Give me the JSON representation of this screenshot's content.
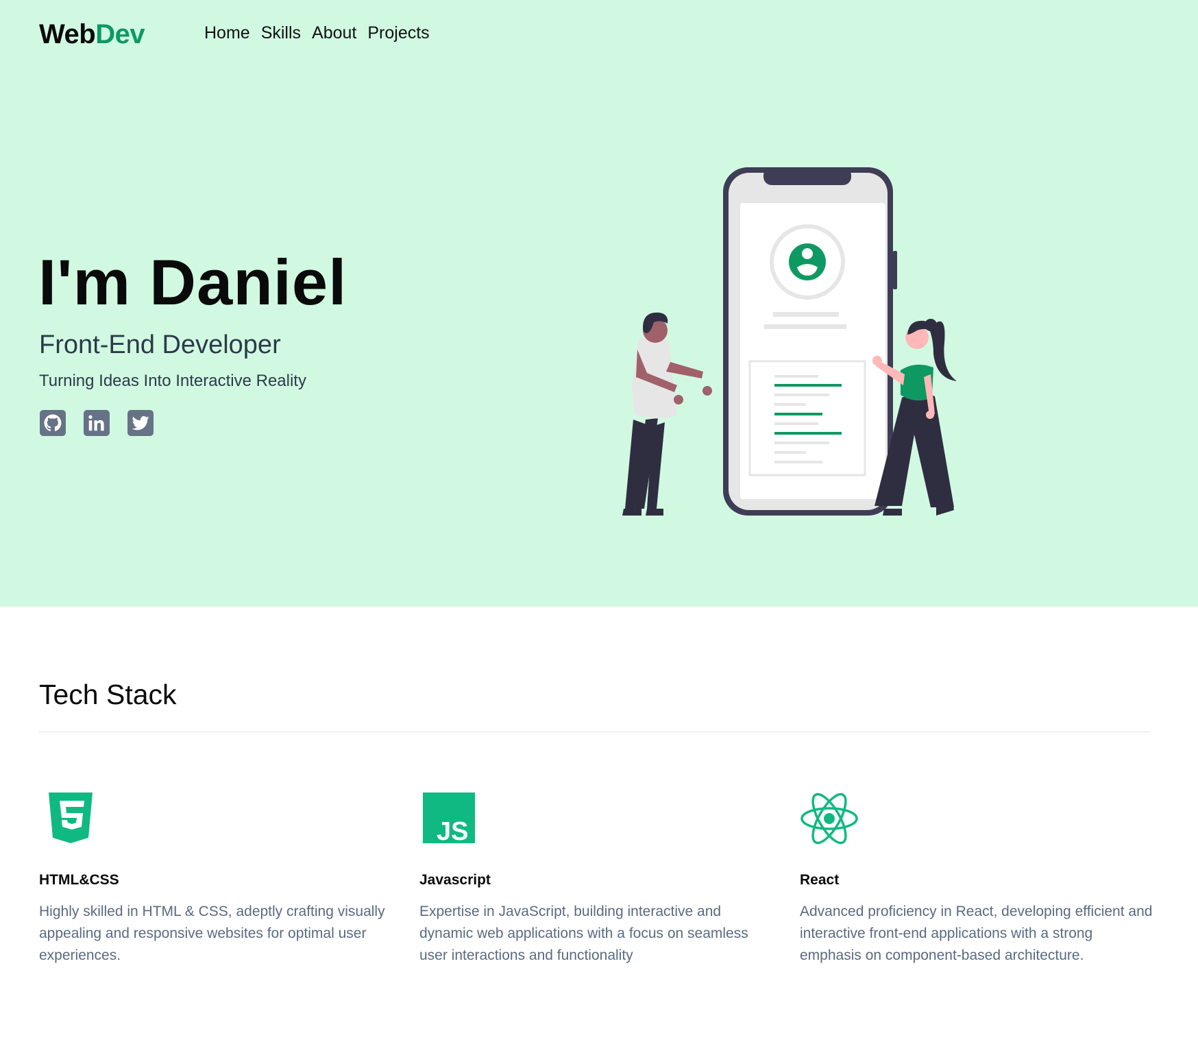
{
  "brand": {
    "part1": "Web",
    "part2": "Dev",
    "accent_color": "#0e9962"
  },
  "nav": [
    {
      "label": "Home"
    },
    {
      "label": "Skills"
    },
    {
      "label": "About"
    },
    {
      "label": "Projects"
    }
  ],
  "hero": {
    "title": "I'm Daniel",
    "role": "Front-End Developer",
    "tagline": "Turning Ideas Into Interactive Reality",
    "background_color": "#d1f9e1",
    "socials": [
      {
        "icon": "github-icon"
      },
      {
        "icon": "linkedin-icon"
      },
      {
        "icon": "twitter-icon"
      }
    ]
  },
  "tech_stack": {
    "title": "Tech Stack",
    "items": [
      {
        "icon": "html5-icon",
        "name": "HTML&CSS",
        "description": "Highly skilled in HTML & CSS, adeptly crafting visually appealing and responsive websites for optimal user experiences."
      },
      {
        "icon": "javascript-icon",
        "icon_text": "JS",
        "name": "Javascript",
        "description": "Expertise in JavaScript, building interactive and dynamic web applications with a focus on seamless user interactions and functionality"
      },
      {
        "icon": "react-icon",
        "name": "React",
        "description": "Advanced proficiency in React, developing efficient and interactive front-end applications with a strong emphasis on component-based architecture."
      }
    ]
  }
}
